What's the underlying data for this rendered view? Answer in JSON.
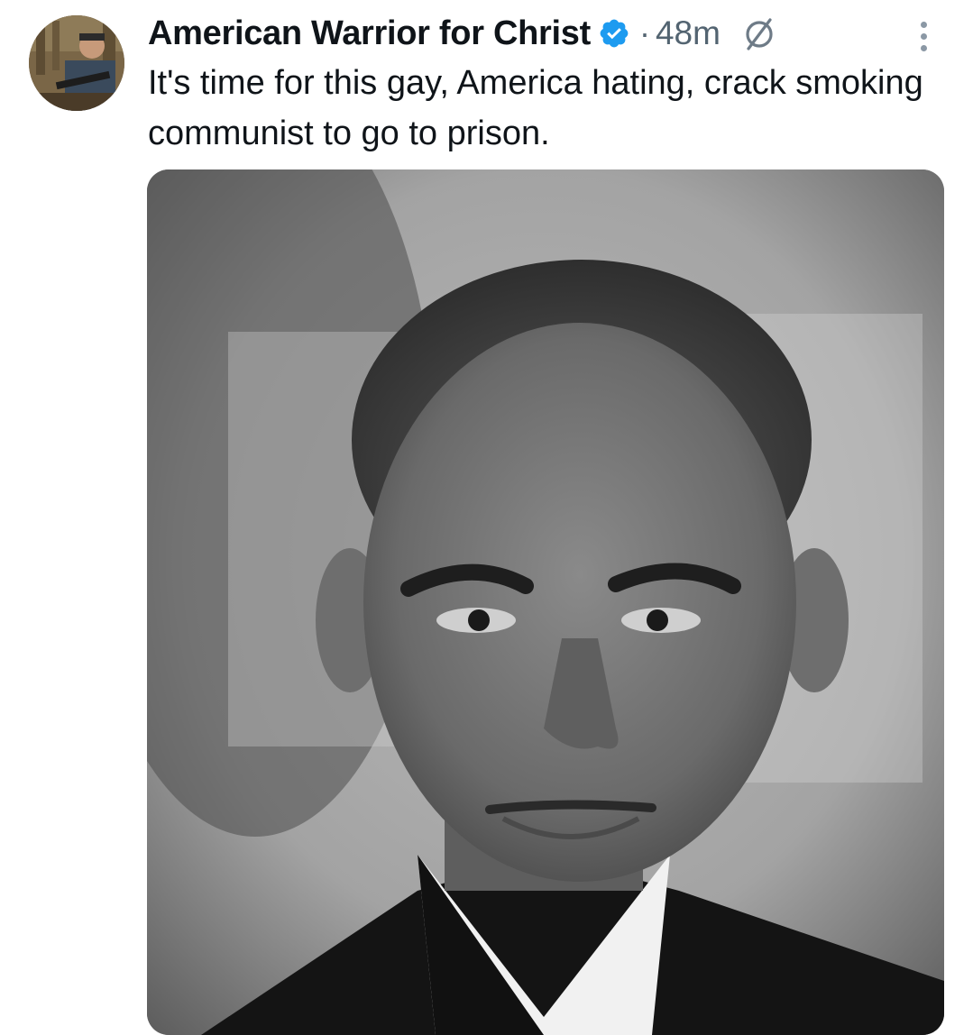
{
  "tweet": {
    "author": {
      "display_name": "American Warrior for Christ",
      "verified_icon": "verified-badge-icon",
      "avatar_icon": "avatar"
    },
    "separator": "·",
    "timestamp": "48m",
    "status_icon": "null-symbol-icon",
    "more_icon": "more-options-icon",
    "text": "It's time for this gay, America hating, crack smoking communist to go to prison.",
    "media": {
      "type": "photo",
      "style": "black-and-white portrait"
    }
  },
  "colors": {
    "text_primary": "#0f1419",
    "text_secondary": "#536471",
    "verified_blue": "#1d9bf0",
    "background": "#ffffff"
  }
}
